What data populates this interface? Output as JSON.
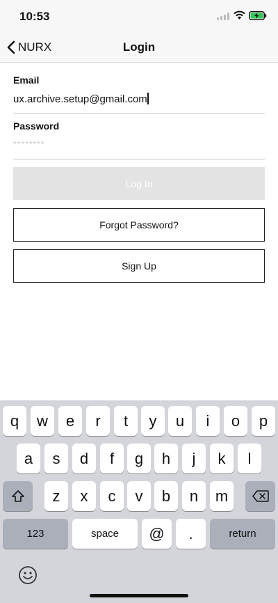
{
  "status_bar": {
    "time": "10:53"
  },
  "nav": {
    "back_label": "NURX",
    "title": "Login"
  },
  "form": {
    "email_label": "Email",
    "email_value": "ux.archive.setup@gmail.com",
    "password_label": "Password",
    "password_value": "********"
  },
  "buttons": {
    "login": "Log In",
    "forgot": "Forgot Password?",
    "signup": "Sign Up"
  },
  "keyboard": {
    "row1": [
      "q",
      "w",
      "e",
      "r",
      "t",
      "y",
      "u",
      "i",
      "o",
      "p"
    ],
    "row2": [
      "a",
      "s",
      "d",
      "f",
      "g",
      "h",
      "j",
      "k",
      "l"
    ],
    "row3": [
      "z",
      "x",
      "c",
      "v",
      "b",
      "n",
      "m"
    ],
    "numbers": "123",
    "space": "space",
    "at": "@",
    "period": ".",
    "return": "return"
  }
}
